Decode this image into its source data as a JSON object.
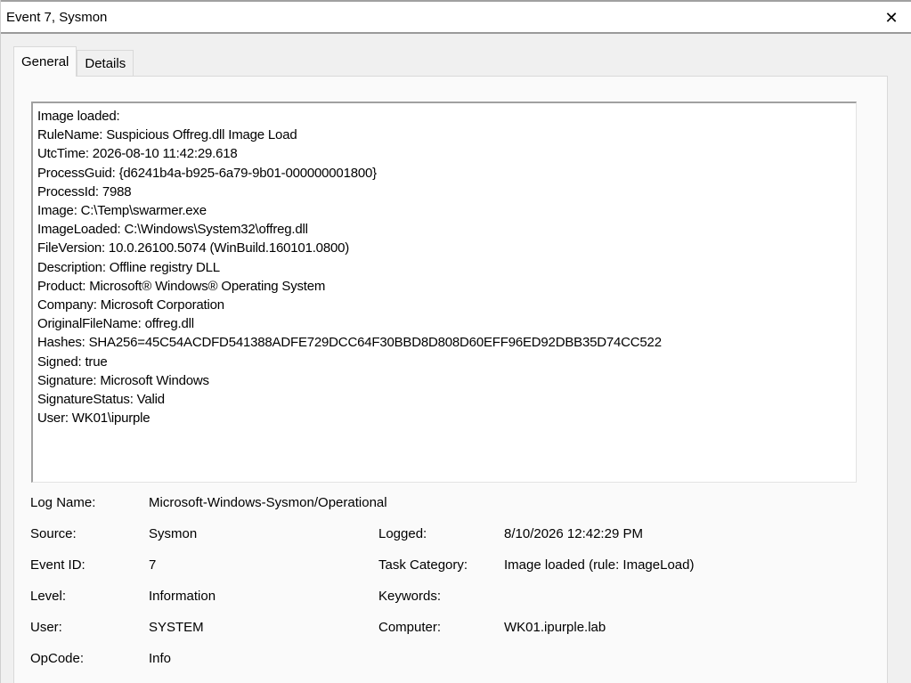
{
  "window": {
    "title": "Event 7, Sysmon",
    "close_symbol": "✕"
  },
  "tabs": [
    {
      "label": "General",
      "active": true
    },
    {
      "label": "Details",
      "active": false
    }
  ],
  "event_description": [
    "Image loaded:",
    "RuleName: Suspicious Offreg.dll Image Load",
    "UtcTime: 2026-08-10 11:42:29.618",
    "ProcessGuid: {d6241b4a-b925-6a79-9b01-000000001800}",
    "ProcessId: 7988",
    "Image: C:\\Temp\\swarmer.exe",
    "ImageLoaded: C:\\Windows\\System32\\offreg.dll",
    "FileVersion: 10.0.26100.5074 (WinBuild.160101.0800)",
    "Description: Offline registry DLL",
    "Product: Microsoft® Windows® Operating System",
    "Company: Microsoft Corporation",
    "OriginalFileName: offreg.dll",
    "Hashes: SHA256=45C54ACDFD541388ADFE729DCC64F30BBD8D808D60EFF96ED92DBB35D74CC522",
    "Signed: true",
    "Signature: Microsoft Windows",
    "SignatureStatus: Valid",
    "User: WK01\\ipurple"
  ],
  "properties": {
    "log_name": {
      "label": "Log Name:",
      "value": "Microsoft-Windows-Sysmon/Operational"
    },
    "source": {
      "label": "Source:",
      "value": "Sysmon"
    },
    "logged": {
      "label": "Logged:",
      "value": "8/10/2026 12:42:29 PM"
    },
    "event_id": {
      "label": "Event ID:",
      "value": "7"
    },
    "task_category": {
      "label": "Task Category:",
      "value": "Image loaded (rule: ImageLoad)"
    },
    "level": {
      "label": "Level:",
      "value": "Information"
    },
    "keywords": {
      "label": "Keywords:",
      "value": ""
    },
    "user": {
      "label": "User:",
      "value": "SYSTEM"
    },
    "computer": {
      "label": "Computer:",
      "value": "WK01.ipurple.lab"
    },
    "opcode": {
      "label": "OpCode:",
      "value": "Info"
    }
  }
}
